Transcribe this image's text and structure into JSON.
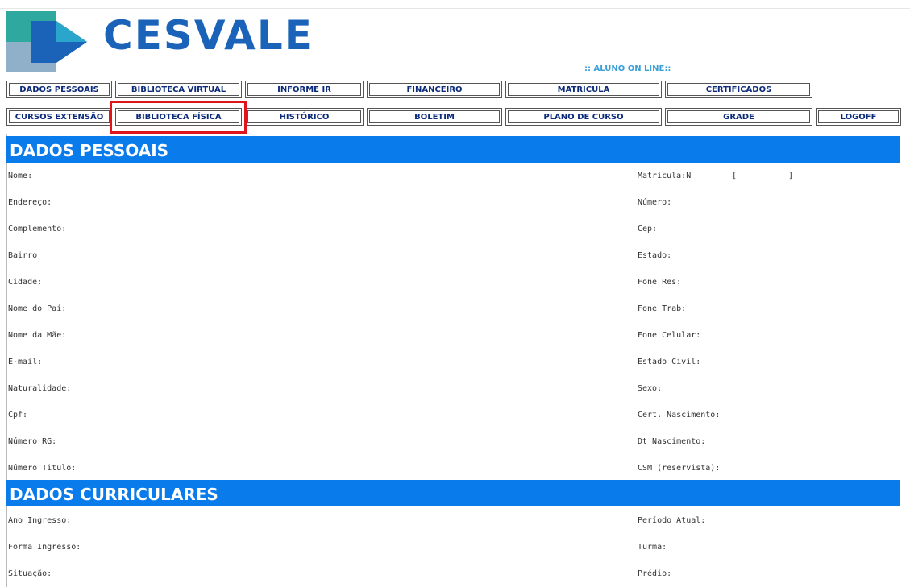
{
  "brand": {
    "logo_text": "CESVALE",
    "subtitle": ":: ALUNO ON LINE::"
  },
  "nav": {
    "row1": [
      "DADOS PESSOAIS",
      "BIBLIOTECA VIRTUAL",
      "INFORME IR",
      "FINANCEIRO",
      "MATRICULA",
      "CERTIFICADOS"
    ],
    "row2": [
      "CURSOS EXTENSÃO",
      "BIBLIOTECA FÍSICA",
      "HISTÓRICO",
      "BOLETIM",
      "PLANO DE CURSO",
      "GRADE",
      "LOGOFF"
    ]
  },
  "sections": {
    "pessoais": "DADOS PESSOAIS",
    "curriculares": "DADOS CURRICULARES"
  },
  "pessoais_left": [
    "Nome:",
    "Endereço:",
    "Complemento:",
    "Bairro",
    "Cidade:",
    "Nome do Pai:",
    "Nome da Mãe:",
    "E-mail:",
    "Naturalidade:",
    "Cpf:",
    "Número RG:",
    "Número Titulo:"
  ],
  "pessoais_right": [
    "Matricula:N",
    "Número:",
    "Cep:",
    "Estado:",
    "Fone Res:",
    "Fone Trab:",
    "Fone Celular:",
    "Estado Civil:",
    "Sexo:",
    "Cert. Nascimento:",
    "Dt Nascimento:",
    "CSM (reservista):"
  ],
  "matricula_brackets": {
    "open": "[",
    "close": "]"
  },
  "curriculares_left": [
    "Ano Ingresso:",
    "Forma Ingresso:",
    "Situação:"
  ],
  "curriculares_right": [
    "Período Atual:",
    "Turma:",
    "Prédio:"
  ],
  "colors": {
    "section_bg": "#0a7bea",
    "nav_text": "#0b2a7a",
    "highlight": "#e0141b",
    "logo": "#1a63b8"
  }
}
